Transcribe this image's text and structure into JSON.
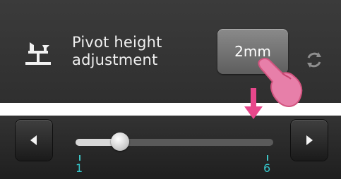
{
  "header": {
    "title_line1": "Pivot height",
    "title_line2": "adjustment",
    "value_button_label": "2mm"
  },
  "icons": {
    "pivot": "pivot-height-icon",
    "reset": "refresh-icon",
    "touch": "pointing-hand-icon",
    "arrow": "down-arrow-icon",
    "left": "arrow-left-icon",
    "right": "arrow-right-icon"
  },
  "slider": {
    "min_label": "1",
    "max_label": "6",
    "min": 1,
    "max": 6,
    "value": 2
  },
  "colors": {
    "accent_pink": "#e8478b",
    "tick_cyan": "#35c4c9",
    "panel_dark": "#2f2f2f"
  }
}
